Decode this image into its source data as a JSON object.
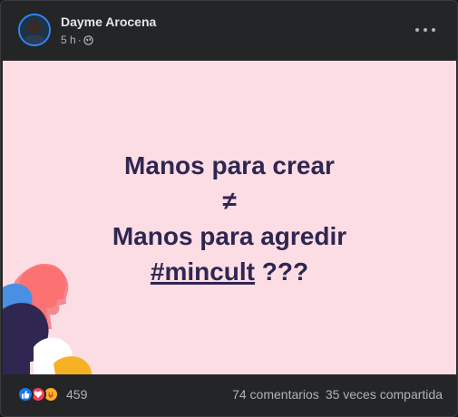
{
  "post": {
    "author": "Dayme Arocena",
    "time": "5 h",
    "separator": "·",
    "privacy_icon": "globe-icon",
    "more_icon": "more-options-icon"
  },
  "image": {
    "background": "#fcdde3",
    "text_color": "#2f2652",
    "line1": "Manos para crear",
    "line2": "≠",
    "line3": "Manos para agredir",
    "hashtag": "#mincult",
    "hashtag_suffix": " ???"
  },
  "footer": {
    "reaction_icons": [
      "like-icon",
      "love-icon",
      "care-icon"
    ],
    "reaction_count": "459",
    "comments": "74 comentarios",
    "shares": "35 veces compartida"
  },
  "colors": {
    "card": "#242526",
    "text_primary": "#e4e6eb",
    "text_secondary": "#b0b3b8",
    "like": "#1877f2",
    "love": "#f33e58",
    "care": "#f7b125"
  }
}
